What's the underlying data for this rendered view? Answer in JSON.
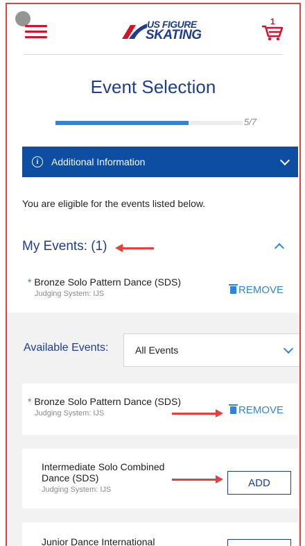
{
  "header": {
    "logo_line1": "US FIGURE",
    "logo_line2": "SKATING",
    "cart_count": "1",
    "icons": {
      "menu": "hamburger-icon",
      "cart": "cart-icon"
    }
  },
  "page": {
    "title": "Event Selection",
    "progress_label": "5/7",
    "progress_fraction": 0.71
  },
  "info_bar": {
    "label": "Additional Information"
  },
  "eligible_text": "You are eligible for the events listed below.",
  "my_events": {
    "heading": "My Events: (1)",
    "items": [
      {
        "name": "Bronze Solo Pattern Dance (SDS)",
        "star": "*",
        "judging": "Judging System: IJS",
        "action": "REMOVE"
      }
    ]
  },
  "available": {
    "label": "Available Events:",
    "filter_selected": "All Events",
    "items": [
      {
        "name": "Bronze Solo Pattern Dance (SDS)",
        "star": "*",
        "judging": "Judging System: IJS",
        "action": "REMOVE"
      },
      {
        "name_line1": "Intermediate Solo Combined",
        "name_line2": "Dance (SDS)",
        "judging": "Judging System: IJS",
        "action": "ADD"
      },
      {
        "name": "Junior Dance International"
      }
    ]
  },
  "colors": {
    "brand_blue": "#1c3d92",
    "accent_blue": "#2f86d6",
    "info_bar": "#0d4ea2",
    "brand_red": "#d4122a",
    "annotation_red": "#e3413a"
  }
}
